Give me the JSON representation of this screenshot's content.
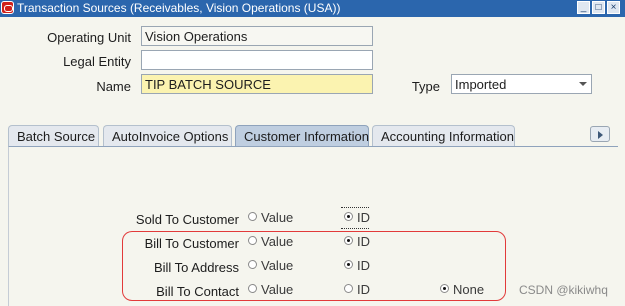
{
  "window": {
    "title": "Transaction Sources (Receivables, Vision Operations (USA))",
    "buttons": {
      "minimize": "_",
      "maximize": "□",
      "close": "×"
    }
  },
  "header": {
    "operating_unit": {
      "label": "Operating Unit",
      "value": "Vision Operations"
    },
    "legal_entity": {
      "label": "Legal Entity",
      "value": ""
    },
    "name": {
      "label": "Name",
      "value": "TIP BATCH SOURCE"
    },
    "type": {
      "label": "Type",
      "value": "Imported"
    }
  },
  "tabs": [
    {
      "label": "Batch Source",
      "active": false
    },
    {
      "label": "AutoInvoice Options",
      "active": false
    },
    {
      "label": "Customer Information",
      "active": true
    },
    {
      "label": "Accounting Information",
      "active": false
    }
  ],
  "customer_information": {
    "rows": [
      {
        "label": "Sold To Customer",
        "options": [
          "Value",
          "ID"
        ],
        "selected": "ID"
      },
      {
        "label": "Bill To Customer",
        "options": [
          "Value",
          "ID"
        ],
        "selected": "ID"
      },
      {
        "label": "Bill To Address",
        "options": [
          "Value",
          "ID"
        ],
        "selected": "ID"
      },
      {
        "label": "Bill To Contact",
        "options": [
          "Value",
          "ID",
          "None"
        ],
        "selected": "None"
      }
    ]
  },
  "watermark": "CSDN @kikiwhq",
  "colors": {
    "titlebar": "#2b66ad",
    "required_field": "#fbf3b0",
    "active_tab": "#bfcee0",
    "highlight_box": "#e23a3a"
  }
}
